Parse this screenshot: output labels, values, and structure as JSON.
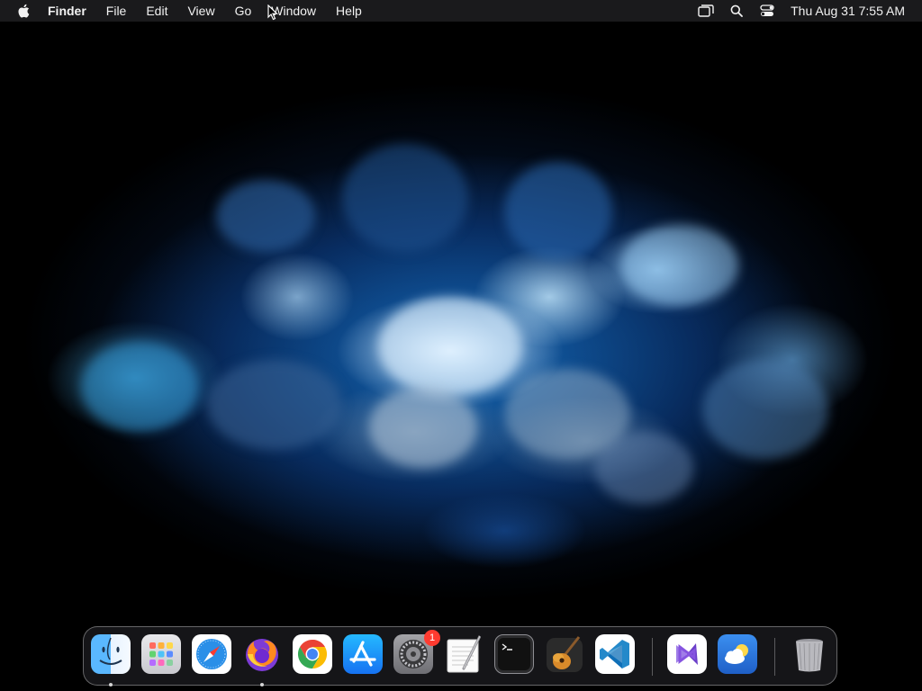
{
  "menubar": {
    "app_name": "Finder",
    "menus": [
      "File",
      "Edit",
      "View",
      "Go",
      "Window",
      "Help"
    ],
    "clock": "Thu Aug 31  7:55 AM",
    "icons": {
      "apple": "apple-logo-icon",
      "screen_mirroring": "screen-mirroring-icon",
      "spotlight": "search-icon",
      "control_center": "control-center-icon"
    }
  },
  "dock": {
    "apps": [
      {
        "name": "Finder",
        "icon": "finder-icon",
        "running": true
      },
      {
        "name": "Launchpad",
        "icon": "launchpad-icon",
        "running": false
      },
      {
        "name": "Safari",
        "icon": "safari-icon",
        "running": false
      },
      {
        "name": "Firefox",
        "icon": "firefox-icon",
        "running": true
      },
      {
        "name": "Google Chrome",
        "icon": "chrome-icon",
        "running": false
      },
      {
        "name": "App Store",
        "icon": "app-store-icon",
        "running": false
      },
      {
        "name": "System Settings",
        "icon": "system-settings-icon",
        "running": false,
        "badge": "1"
      },
      {
        "name": "TextEdit",
        "icon": "textedit-icon",
        "running": false
      },
      {
        "name": "Terminal",
        "icon": "terminal-icon",
        "running": false
      },
      {
        "name": "GarageBand",
        "icon": "garageband-icon",
        "running": false
      },
      {
        "name": "Visual Studio Code",
        "icon": "vscode-icon",
        "running": false
      }
    ],
    "recent_apps": [
      {
        "name": "Visual Studio",
        "icon": "visual-studio-icon",
        "running": false
      },
      {
        "name": "Weather",
        "icon": "weather-icon",
        "running": false
      }
    ],
    "trash": {
      "name": "Trash",
      "icon": "trash-icon"
    }
  },
  "colors": {
    "menubar_bg": "#1c1c1e",
    "badge": "#ff3b30",
    "wallpaper_accent": "#1e6fbf"
  }
}
